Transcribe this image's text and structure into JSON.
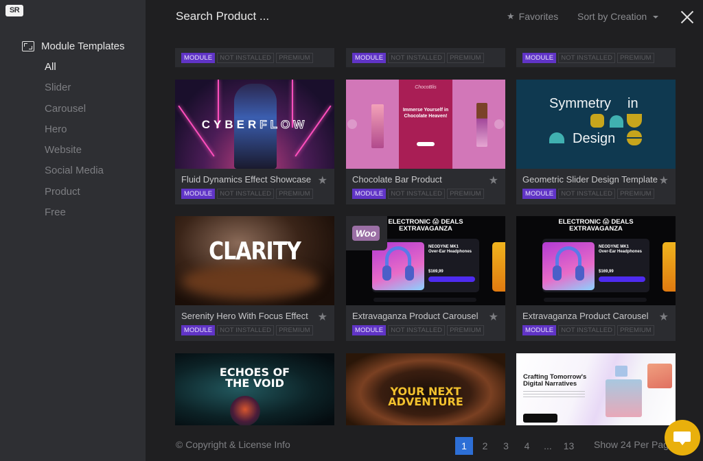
{
  "app": {
    "logo_text": "SR"
  },
  "sidebar": {
    "heading": "Module Templates",
    "items": [
      {
        "label": "All",
        "active": true
      },
      {
        "label": "Slider"
      },
      {
        "label": "Carousel"
      },
      {
        "label": "Hero"
      },
      {
        "label": "Website"
      },
      {
        "label": "Social Media"
      },
      {
        "label": "Product"
      },
      {
        "label": "Free"
      }
    ]
  },
  "header": {
    "search_placeholder": "Search Product ...",
    "favorites_label": "Favorites",
    "sort_label": "Sort by Creation"
  },
  "tags": {
    "module": "MODULE",
    "not_installed": "NOT INSTALLED",
    "premium": "PREMIUM"
  },
  "cards": [
    {
      "title": "",
      "thumb": "partial-top"
    },
    {
      "title": "",
      "thumb": "partial-top"
    },
    {
      "title": "",
      "thumb": "partial-top"
    },
    {
      "title": "Fluid Dynamics Effect Showcase",
      "thumb_text": [
        "CYBER",
        "FLOW"
      ]
    },
    {
      "title": "Chocolate Bar Product",
      "thumb_text": [
        "ChocoBlis",
        "Immerse Yourself in Chocolate Heaven!"
      ]
    },
    {
      "title": "Geometric Slider Design Template",
      "thumb_text": [
        "Symmetry",
        "in",
        "Design"
      ]
    },
    {
      "title": "Serenity Hero With Focus Effect",
      "thumb_text": [
        "CLARITY"
      ]
    },
    {
      "title": "Extravaganza Product Carousel",
      "thumb_text": [
        "ELECTRONIC 😱 DEALS",
        "EXTRAVAGANZA",
        "NEODYNE MK1",
        "Over-Ear Headphones",
        "$169,99"
      ],
      "badge": "Woo"
    },
    {
      "title": "Extravaganza Product Carousel",
      "thumb_text": [
        "ELECTRONIC 😱 DEALS",
        "EXTRAVAGANZA",
        "NEODYNE MK1",
        "Over-Ear Headphones",
        "$169,99"
      ]
    },
    {
      "title": "",
      "thumb_text": [
        "ECHOES OF",
        "THE VOID"
      ]
    },
    {
      "title": "",
      "thumb_text": [
        "YOUR NEXT",
        "ADVENTURE"
      ]
    },
    {
      "title": "",
      "thumb_text": [
        "Crafting Tomorrow's",
        "Digital Narratives"
      ]
    }
  ],
  "footer": {
    "copyright": "© Copyright & License Info",
    "pages": [
      "1",
      "2",
      "3",
      "4",
      "...",
      "13"
    ],
    "current_page": "1",
    "per_page": "Show 24 Per Page"
  },
  "colors": {
    "accent_module": "#6034c6",
    "pager_active": "#2d6fd6",
    "chat_button": "#e9b00c"
  }
}
